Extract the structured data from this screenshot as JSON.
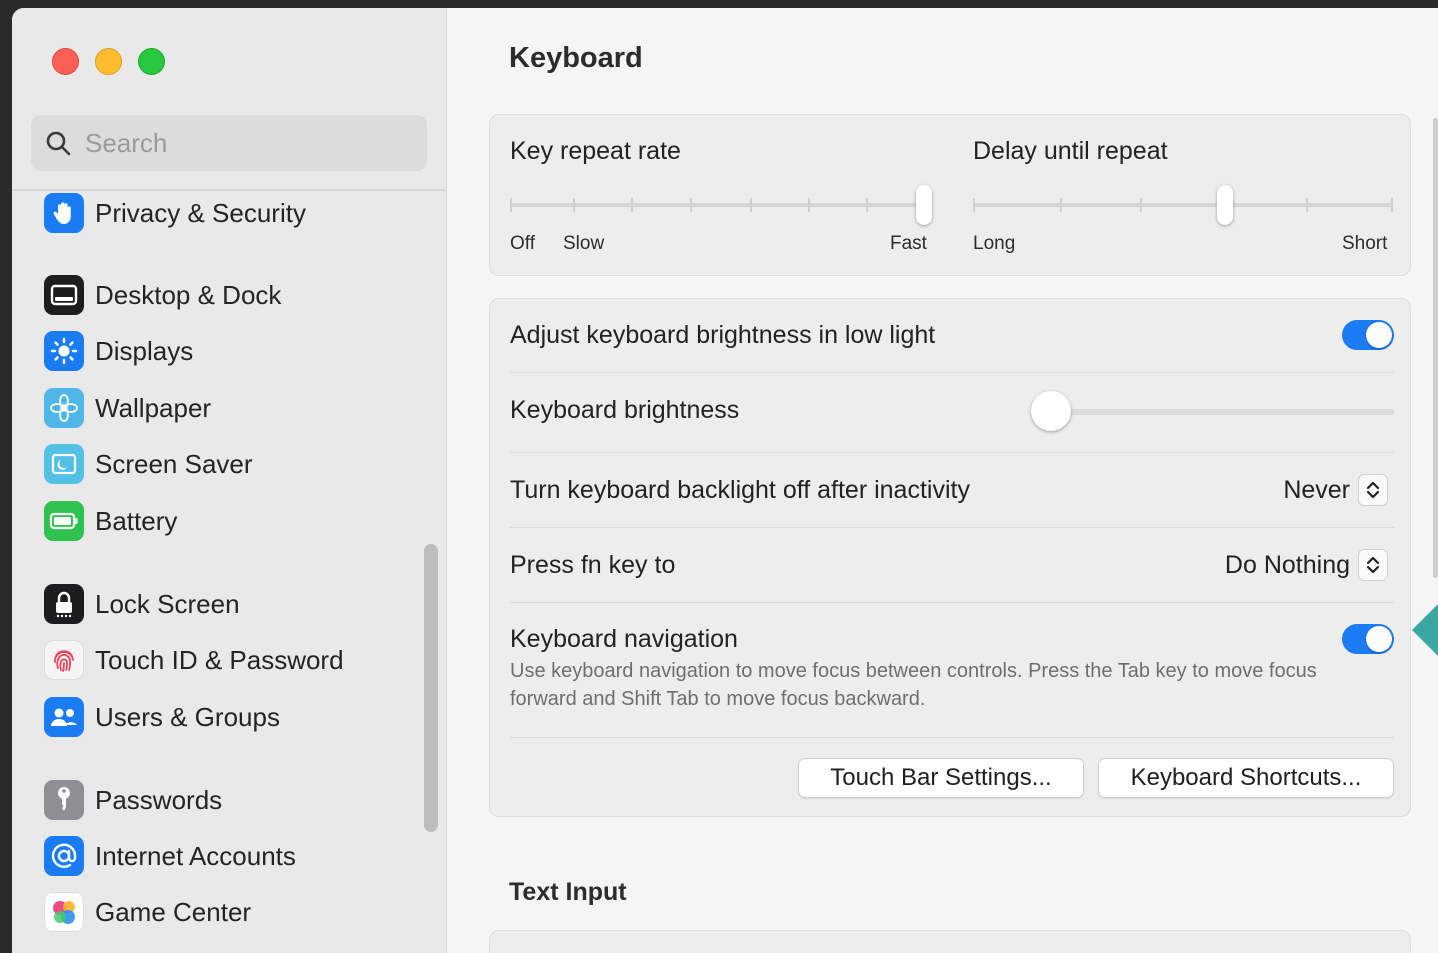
{
  "sidebar": {
    "search_placeholder": "Search",
    "items": [
      {
        "label": "Privacy & Security",
        "icon": "hand-icon",
        "color": "#1a7cf2"
      },
      {
        "label": "Desktop & Dock",
        "icon": "dock-icon",
        "color": "#1d1d1f"
      },
      {
        "label": "Displays",
        "icon": "sun-icon",
        "color": "#1a7cf2"
      },
      {
        "label": "Wallpaper",
        "icon": "flower-icon",
        "color": "#4fb6e8"
      },
      {
        "label": "Screen Saver",
        "icon": "screensaver-icon",
        "color": "#53c1e6"
      },
      {
        "label": "Battery",
        "icon": "battery-icon",
        "color": "#2fc24f"
      },
      {
        "label": "Lock Screen",
        "icon": "lock-icon",
        "color": "#1d1d1f"
      },
      {
        "label": "Touch ID & Password",
        "icon": "fingerprint-icon",
        "color": "#f5f5f5"
      },
      {
        "label": "Users & Groups",
        "icon": "users-icon",
        "color": "#1a7cf2"
      },
      {
        "label": "Passwords",
        "icon": "key-icon",
        "color": "#8e8e93"
      },
      {
        "label": "Internet Accounts",
        "icon": "at-icon",
        "color": "#1a7cf2"
      },
      {
        "label": "Game Center",
        "icon": "game-center-icon",
        "color": "#ffffff"
      }
    ]
  },
  "main": {
    "title": "Keyboard",
    "key_repeat": {
      "label": "Key repeat rate",
      "off": "Off",
      "slow": "Slow",
      "fast": "Fast",
      "value_fraction": 1.0
    },
    "delay_repeat": {
      "label": "Delay until repeat",
      "long": "Long",
      "short": "Short",
      "value_fraction": 0.6
    },
    "adjust_brightness": {
      "label": "Adjust keyboard brightness in low light",
      "enabled": true
    },
    "keyboard_brightness": {
      "label": "Keyboard brightness",
      "value_fraction": 0.0
    },
    "backlight_off": {
      "label": "Turn keyboard backlight off after inactivity",
      "value": "Never"
    },
    "fn_key": {
      "label": "Press fn key to",
      "value": "Do Nothing"
    },
    "keyboard_navigation": {
      "label": "Keyboard navigation",
      "enabled": true,
      "description": "Use keyboard navigation to move focus between controls. Press the Tab key to move focus forward and Shift Tab to move focus backward."
    },
    "buttons": {
      "touch_bar": "Touch Bar Settings...",
      "shortcuts": "Keyboard Shortcuts..."
    },
    "text_input_title": "Text Input"
  },
  "colors": {
    "accent": "#1c7cf4",
    "callout": "#3aa7a3"
  }
}
